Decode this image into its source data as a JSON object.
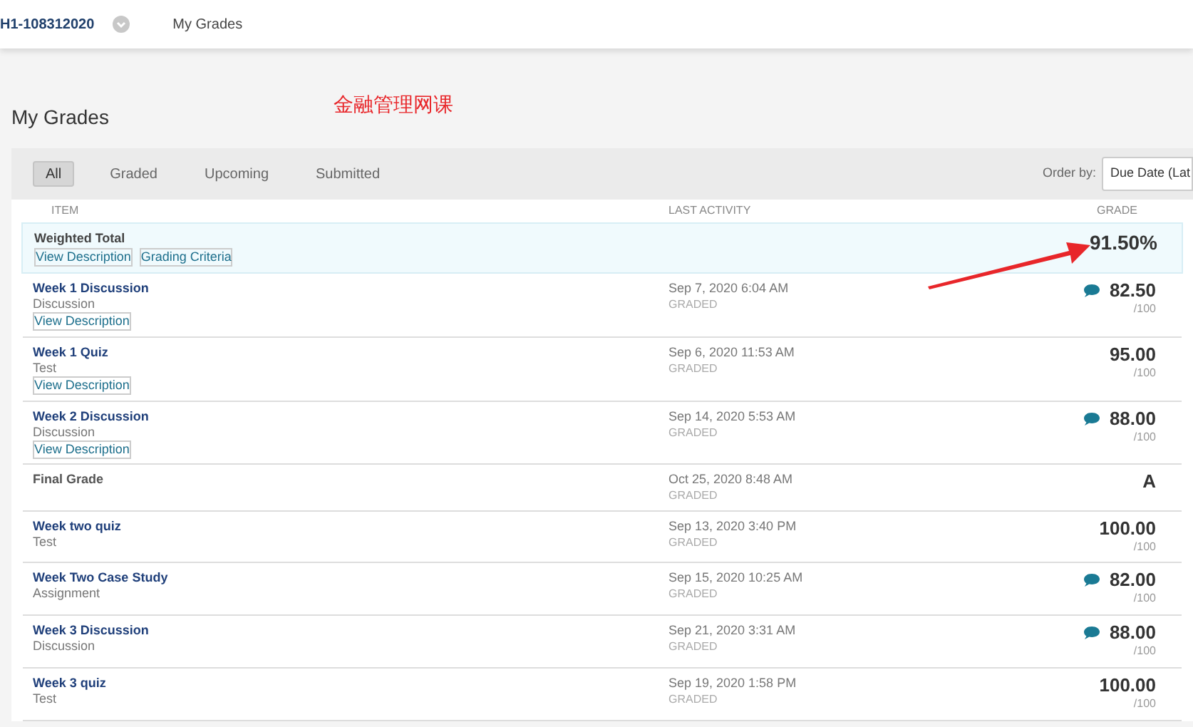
{
  "breadcrumb": {
    "course": "H1-108312020",
    "page": "My Grades"
  },
  "title": "My Grades",
  "annotation": "金融管理网课",
  "filters": [
    {
      "label": "All",
      "selected": true
    },
    {
      "label": "Graded",
      "selected": false
    },
    {
      "label": "Upcoming",
      "selected": false
    },
    {
      "label": "Submitted",
      "selected": false
    }
  ],
  "order_by": {
    "label": "Order by:",
    "value": "Due Date (Lat"
  },
  "columns": [
    "ITEM",
    "LAST ACTIVITY",
    "GRADE"
  ],
  "total": {
    "name": "Weighted Total",
    "links": [
      "View Description",
      "Grading Criteria"
    ],
    "grade": "91.50%"
  },
  "rows": [
    {
      "kind": "link",
      "name": "Week 1 Discussion",
      "type": "Discussion",
      "link": "View Description",
      "date": "Sep 7, 2020 6:04 AM",
      "status": "GRADED",
      "grade": "82.50",
      "out_of": "/100",
      "feedback": true
    },
    {
      "kind": "link",
      "name": "Week 1 Quiz",
      "type": "Test",
      "link": "View Description",
      "date": "Sep 6, 2020 11:53 AM",
      "status": "GRADED",
      "grade": "95.00",
      "out_of": "/100",
      "feedback": false
    },
    {
      "kind": "link",
      "name": "Week 2 Discussion",
      "type": "Discussion",
      "link": "View Description",
      "date": "Sep 14, 2020 5:53 AM",
      "status": "GRADED",
      "grade": "88.00",
      "out_of": "/100",
      "feedback": true
    },
    {
      "kind": "plain",
      "name": "Final Grade",
      "date": "Oct 25, 2020 8:48 AM",
      "status": "GRADED",
      "grade": "A",
      "feedback": false
    },
    {
      "kind": "link",
      "name": "Week two quiz",
      "type": "Test",
      "date": "Sep 13, 2020 3:40 PM",
      "status": "GRADED",
      "grade": "100.00",
      "out_of": "/100",
      "feedback": false
    },
    {
      "kind": "link",
      "name": "Week Two Case Study",
      "type": "Assignment",
      "date": "Sep 15, 2020 10:25 AM",
      "status": "GRADED",
      "grade": "82.00",
      "out_of": "/100",
      "feedback": true
    },
    {
      "kind": "link",
      "name": "Week 3 Discussion",
      "type": "Discussion",
      "date": "Sep 21, 2020 3:31 AM",
      "status": "GRADED",
      "grade": "88.00",
      "out_of": "/100",
      "feedback": true
    },
    {
      "kind": "link",
      "name": "Week 3 quiz",
      "type": "Test",
      "date": "Sep 19, 2020 1:58 PM",
      "status": "GRADED",
      "grade": "100.00",
      "out_of": "/100",
      "feedback": false
    }
  ]
}
